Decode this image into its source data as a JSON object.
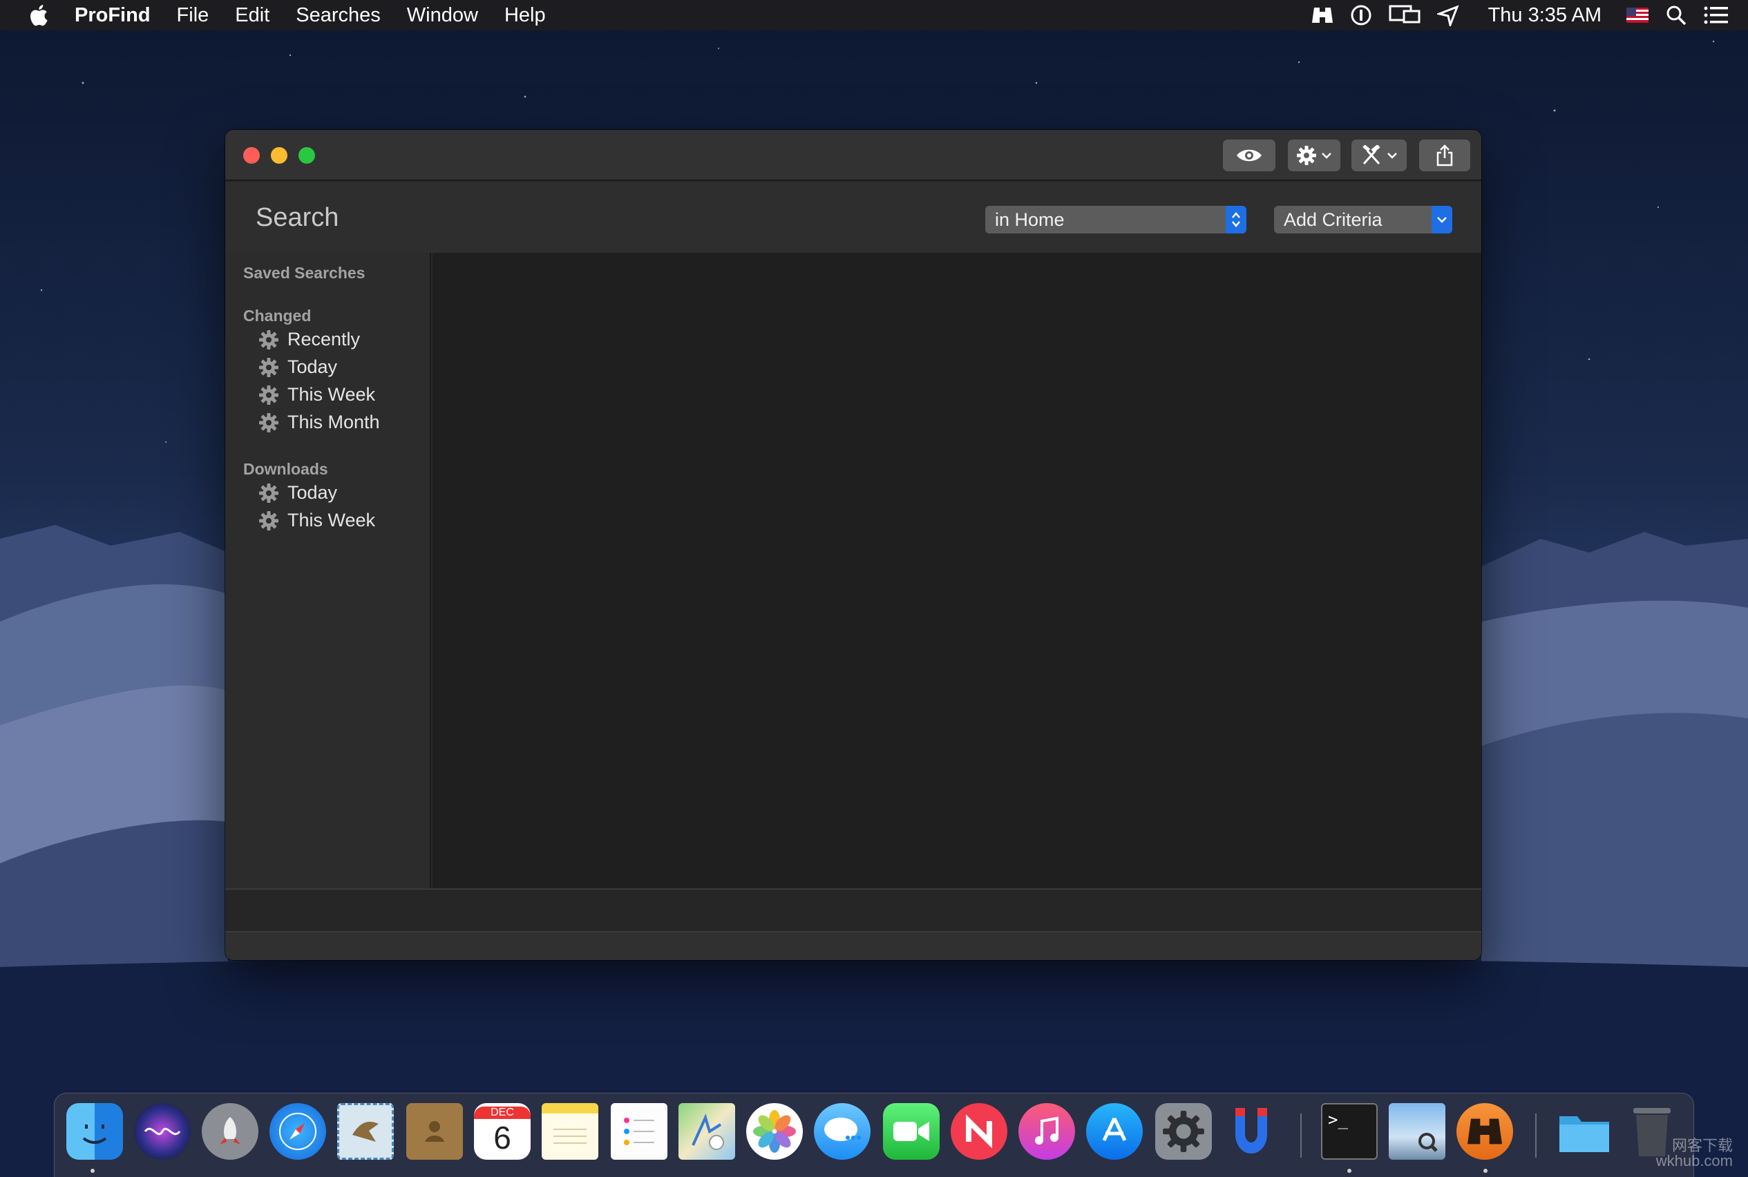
{
  "menubar": {
    "app_name": "ProFind",
    "menus": [
      "File",
      "Edit",
      "Searches",
      "Window",
      "Help"
    ],
    "clock": "Thu 3:35 AM",
    "status_icons": [
      "binoculars-icon",
      "1password-icon",
      "display-mirror-icon",
      "location-icon",
      "us-flag-icon",
      "spotlight-icon",
      "notification-center-icon"
    ]
  },
  "window": {
    "search_title": "Search",
    "scope_popup": "in Home",
    "criteria_popup": "Add Criteria",
    "toolbar_icons": [
      "eye-icon",
      "gear-icon",
      "tools-icon",
      "share-icon"
    ]
  },
  "sidebar": {
    "saved_searches": "Saved Searches",
    "sections": [
      {
        "title": "Changed",
        "items": [
          "Recently",
          "Today",
          "This Week",
          "This Month"
        ]
      },
      {
        "title": "Downloads",
        "items": [
          "Today",
          "This Week"
        ]
      }
    ]
  },
  "dock": {
    "apps": [
      "Finder",
      "Siri",
      "Launchpad",
      "Safari",
      "Mail",
      "Contacts",
      "Calendar",
      "Notes",
      "Reminders",
      "Maps",
      "Photos",
      "Messages",
      "FaceTime",
      "News",
      "iTunes",
      "App Store",
      "System Preferences",
      "Magnet",
      "Terminal",
      "Preview",
      "ProFind",
      "Downloads",
      "Trash"
    ],
    "calendar_month": "DEC",
    "calendar_day": "6",
    "terminal_prompt": ">_"
  },
  "watermark": {
    "line1": "网客下载",
    "line2": "wkhub.com"
  }
}
